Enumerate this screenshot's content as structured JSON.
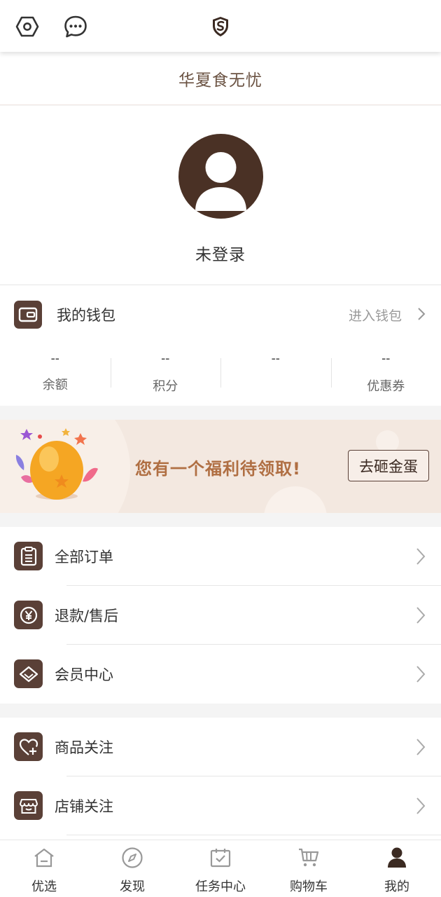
{
  "header": {
    "app_title": "华夏食无忧",
    "icons": [
      "settings-icon",
      "message-icon",
      "shield-logo-icon"
    ]
  },
  "profile": {
    "login_status": "未登录"
  },
  "wallet": {
    "title": "我的钱包",
    "link_label": "进入钱包",
    "stats": [
      {
        "value": "--",
        "label": "余额"
      },
      {
        "value": "--",
        "label": "积分"
      },
      {
        "value": "--",
        "label": ""
      },
      {
        "value": "--",
        "label": "优惠券"
      }
    ]
  },
  "banner": {
    "text": "您有一个福利待领取!",
    "button_label": "去砸金蛋"
  },
  "menu_group1": [
    {
      "label": "全部订单",
      "icon": "clipboard-icon"
    },
    {
      "label": "退款/售后",
      "icon": "refund-yen-icon"
    },
    {
      "label": "会员中心",
      "icon": "diamond-icon"
    }
  ],
  "menu_group2": [
    {
      "label": "商品关注",
      "icon": "heart-plus-icon"
    },
    {
      "label": "店铺关注",
      "icon": "store-icon"
    }
  ],
  "bottom_nav": [
    {
      "label": "优选",
      "icon": "home-icon",
      "active": false
    },
    {
      "label": "发现",
      "icon": "compass-icon",
      "active": false
    },
    {
      "label": "任务中心",
      "icon": "task-check-icon",
      "active": false
    },
    {
      "label": "购物车",
      "icon": "cart-icon",
      "active": false
    },
    {
      "label": "我的",
      "icon": "person-icon",
      "active": true
    }
  ],
  "colors": {
    "brand_brown": "#5a4037",
    "title_brown": "#6b5343",
    "banner_bg": "#f3e8e0",
    "banner_text": "#b06f43"
  }
}
